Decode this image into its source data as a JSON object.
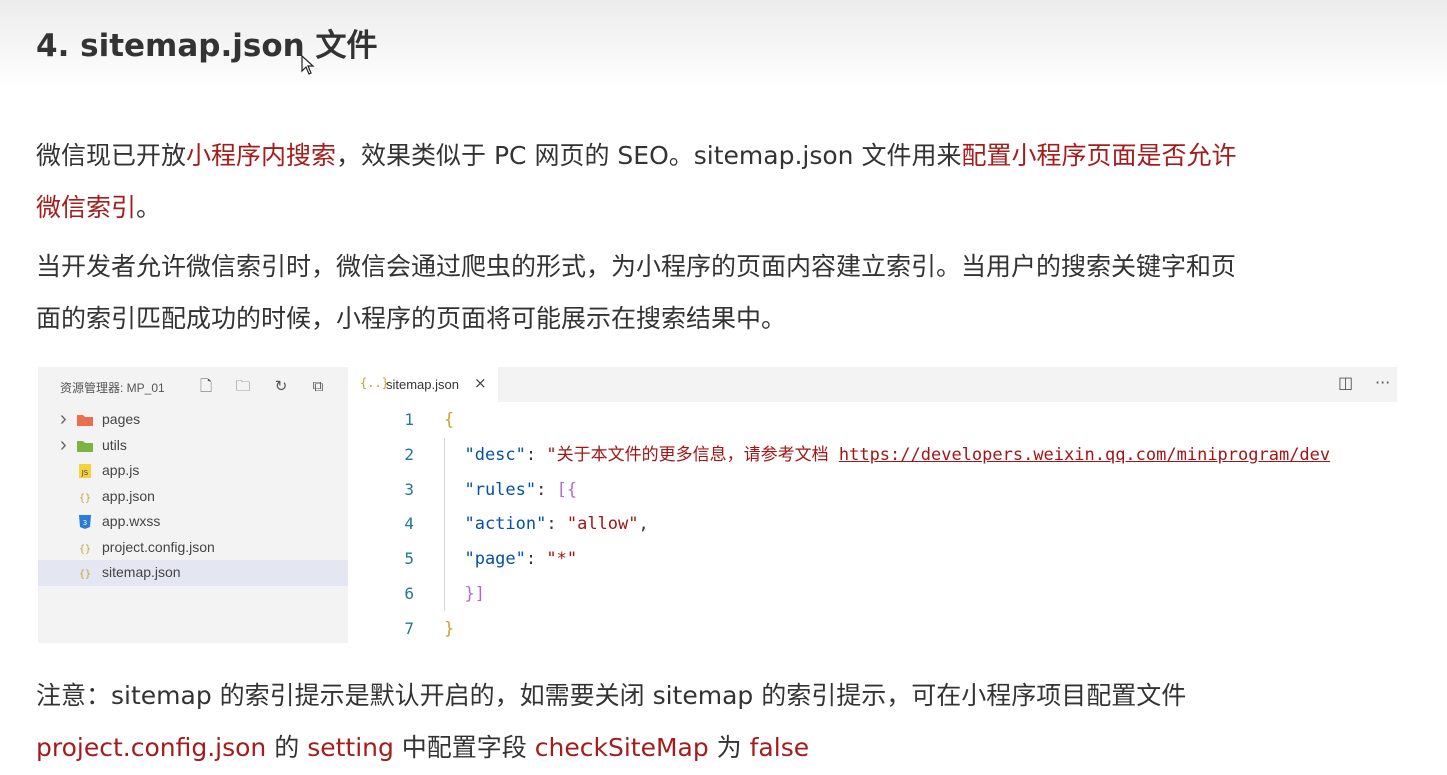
{
  "heading": "4. sitemap.json 文件",
  "para1": {
    "line1": [
      {
        "text": "微信现已开放",
        "hl": false
      },
      {
        "text": "小程序内搜索",
        "hl": true
      },
      {
        "text": "，效果类似于 PC 网页的 SEO。sitemap.json 文件用来",
        "hl": false
      },
      {
        "text": "配置小程序页面是否允许",
        "hl": true
      }
    ],
    "line2": [
      {
        "text": "微信索引",
        "hl": true
      },
      {
        "text": "。",
        "hl": false
      }
    ]
  },
  "para2": {
    "line1": "当开发者允许微信索引时，微信会通过爬虫的形式，为小程序的页面内容建立索引。当用户的搜索关键字和页",
    "line2": "面的索引匹配成功的时候，小程序的页面将可能展示在搜索结果中。"
  },
  "explorer": {
    "title": "资源管理器: MP_01",
    "actions": [
      {
        "name": "new-file-icon",
        "glyph": "🗋"
      },
      {
        "name": "new-folder-icon",
        "glyph": "🗀"
      },
      {
        "name": "refresh-icon",
        "glyph": "↻"
      },
      {
        "name": "collapse-all-icon",
        "glyph": "⧉"
      }
    ],
    "files": [
      {
        "label": "pages",
        "type": "folder",
        "icon": "folder-icon",
        "color": "#e8704e",
        "expandable": true,
        "selected": false
      },
      {
        "label": "utils",
        "type": "folder",
        "icon": "folder-icon",
        "color": "#7cb342",
        "expandable": true,
        "selected": false
      },
      {
        "label": "app.js",
        "type": "js",
        "icon": "js-file-icon",
        "color": "#f5d13c",
        "expandable": false,
        "selected": false
      },
      {
        "label": "app.json",
        "type": "json",
        "icon": "json-file-icon",
        "color": "#c9a227",
        "expandable": false,
        "selected": false
      },
      {
        "label": "app.wxss",
        "type": "css",
        "icon": "css-file-icon",
        "color": "#2a7bd6",
        "expandable": false,
        "selected": false
      },
      {
        "label": "project.config.json",
        "type": "json",
        "icon": "json-file-icon",
        "color": "#c9a227",
        "expandable": false,
        "selected": false
      },
      {
        "label": "sitemap.json",
        "type": "json",
        "icon": "json-file-icon",
        "color": "#c9a227",
        "expandable": false,
        "selected": true
      }
    ]
  },
  "editor": {
    "tab": {
      "icon": "{..}",
      "label": "sitemap.json",
      "close": "×"
    },
    "actions": [
      {
        "name": "split-editor-icon",
        "glyph": "◫"
      },
      {
        "name": "more-actions-icon",
        "glyph": "···"
      }
    ],
    "lines": [
      {
        "n": "1",
        "tokens": [
          {
            "t": "{",
            "c": "brace"
          }
        ]
      },
      {
        "n": "2",
        "tokens": [
          {
            "t": "  \"desc\"",
            "c": "key"
          },
          {
            "t": ": ",
            "c": "punc"
          },
          {
            "t": "\"关于本文件的更多信息，请参考文档 ",
            "c": "str"
          },
          {
            "t": "https://developers.weixin.qq.com/miniprogram/dev",
            "c": "link"
          }
        ]
      },
      {
        "n": "3",
        "tokens": [
          {
            "t": "  \"rules\"",
            "c": "key"
          },
          {
            "t": ": ",
            "c": "punc"
          },
          {
            "t": "[",
            "c": "bracket"
          },
          {
            "t": "{",
            "c": "bracket"
          }
        ]
      },
      {
        "n": "4",
        "tokens": [
          {
            "t": "  \"action\"",
            "c": "key"
          },
          {
            "t": ": ",
            "c": "punc"
          },
          {
            "t": "\"allow\"",
            "c": "str"
          },
          {
            "t": ",",
            "c": "punc"
          }
        ]
      },
      {
        "n": "5",
        "tokens": [
          {
            "t": "  \"page\"",
            "c": "key"
          },
          {
            "t": ": ",
            "c": "punc"
          },
          {
            "t": "\"*\"",
            "c": "str"
          }
        ]
      },
      {
        "n": "6",
        "tokens": [
          {
            "t": "  ",
            "c": "punc"
          },
          {
            "t": "}",
            "c": "bracket"
          },
          {
            "t": "]",
            "c": "bracket"
          }
        ]
      },
      {
        "n": "7",
        "tokens": [
          {
            "t": "}",
            "c": "brace"
          }
        ]
      }
    ]
  },
  "note": {
    "line1": "注意：sitemap 的索引提示是默认开启的，如需要关闭 sitemap 的索引提示，可在小程序项目配置文件",
    "line2": [
      {
        "text": "project.config.json",
        "hl": true
      },
      {
        "text": " 的 ",
        "hl": false
      },
      {
        "text": "setting",
        "hl": true
      },
      {
        "text": " 中配置字段 ",
        "hl": false
      },
      {
        "text": "checkSiteMap",
        "hl": true
      },
      {
        "text": " 为 ",
        "hl": false
      },
      {
        "text": "false",
        "hl": true
      }
    ]
  },
  "colors": {
    "highlight": "#a51c1c",
    "text": "#333333",
    "panel": "#f3f3f3",
    "selected": "#e4e6f1"
  }
}
